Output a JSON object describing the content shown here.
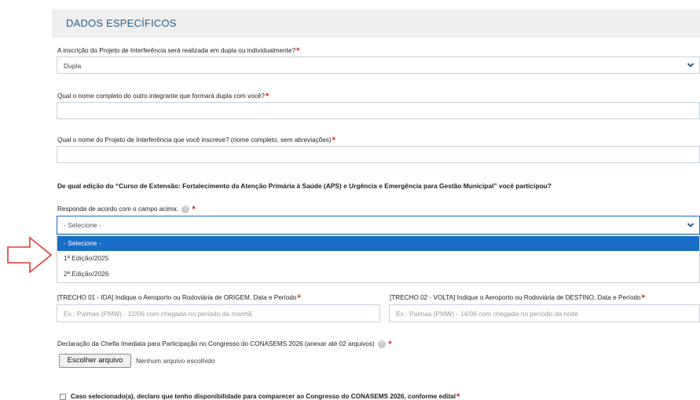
{
  "header": {
    "title": "DADOS ESPECÍFICOS"
  },
  "q1": {
    "label": "A inscrição do Projeto de Interferência será realizada em dupla ou individualmente?",
    "value": "Dupla"
  },
  "q2": {
    "label": "Qual o nome completo do outro integrante que formará dupla com você?",
    "value": ""
  },
  "q3": {
    "label": "Qual o nome do Projeto de Interferência que você inscreve? (nome completo, sem abreviações)",
    "value": ""
  },
  "q4": {
    "question": "De qual edição do “Curso de Extensão: Fortalecimento da Atenção Primária à Saúde (APS) e Urgência e Emergência para Gestão Municipal” você participou?",
    "label": "Responda de acordo com o campo acima:",
    "value": "- Selecione -",
    "options": [
      "- Selecione -",
      "1ª.Edição/2025",
      "2ª.Edição/2026"
    ]
  },
  "trecho1": {
    "label": "[TRECHO 01 - IDA] Indique o Aeroporto ou Rodoviária de ORIGEM, Data e Período",
    "placeholder": "Ex.: Palmas (PMW) - 12/06 com chegada no período da manhã"
  },
  "trecho2": {
    "label": "[TRECHO 02 - VOLTA] Indique o Aeroporto ou Rodoviária de DESTINO, Data e Período",
    "placeholder": "Ex.: Palmas (PMW) - 14/06 com chegada no período da noite"
  },
  "upload": {
    "label": "Declaração da Chefia Imediata para Participação no Congresso do CONASEMS 2026 (anexar até 02 arquivos)",
    "button": "Escolher arquivo",
    "status": "Nenhum arquivo escolhido"
  },
  "agree": {
    "label": "Caso selecionado(a), declaro que tenho disponibilidade para comparecer ao Congresso do CONASEMS 2026, conforme edital"
  },
  "required_mark": "*",
  "help_mark": "?",
  "colors": {
    "accent": "#1a6ec7",
    "title": "#2b5c8a",
    "required": "#e0251b",
    "arrow": "#e53935"
  }
}
